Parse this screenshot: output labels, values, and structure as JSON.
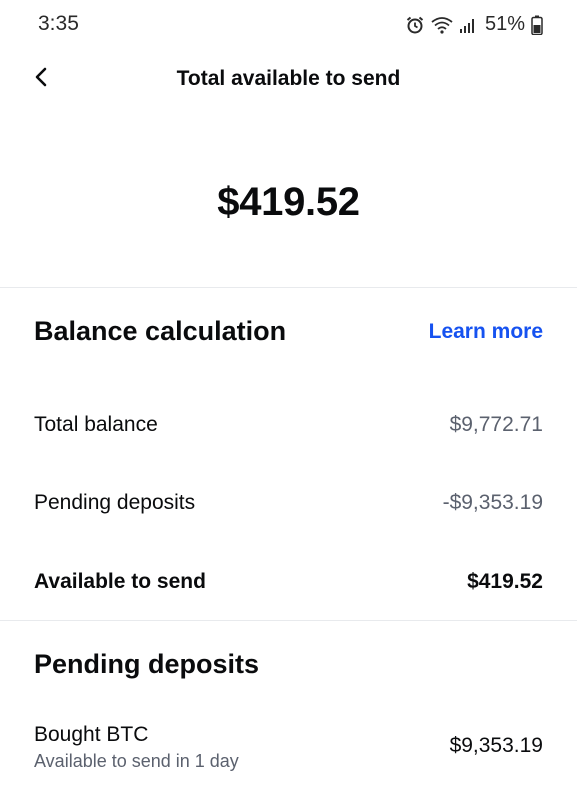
{
  "status_bar": {
    "time": "3:35",
    "battery_percent": "51%",
    "icons": [
      "alarm-icon",
      "wifi-icon",
      "signal-icon",
      "battery-icon"
    ]
  },
  "nav": {
    "back_icon": "chevron-left-icon",
    "title": "Total available to send"
  },
  "hero": {
    "amount": "$419.52"
  },
  "balance_calculation": {
    "heading": "Balance calculation",
    "learn_more": "Learn more",
    "rows": [
      {
        "label": "Total balance",
        "value": "$9,772.71"
      },
      {
        "label": "Pending deposits",
        "value": "-$9,353.19"
      },
      {
        "label": "Available to send",
        "value": "$419.52"
      }
    ]
  },
  "pending_deposits": {
    "heading": "Pending deposits",
    "items": [
      {
        "title": "Bought BTC",
        "subtitle": "Available to send in 1 day",
        "amount": "$9,353.19"
      }
    ]
  },
  "colors": {
    "accent": "#1652f0",
    "text_primary": "#0a0b0d",
    "text_secondary": "#5b616e",
    "divider": "#e8eaed"
  }
}
